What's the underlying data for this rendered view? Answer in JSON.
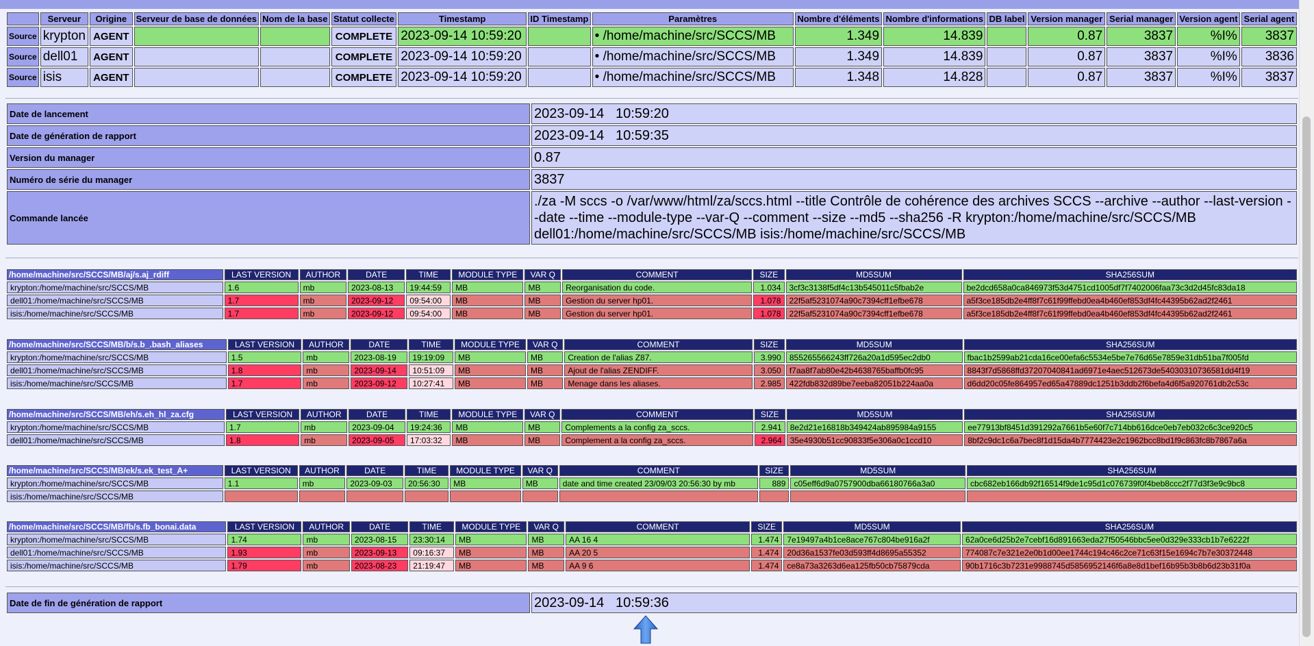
{
  "sources": {
    "headers": [
      "",
      "Serveur",
      "Origine",
      "Serveur de base de données",
      "Nom de la base",
      "Statut collecte",
      "Timestamp",
      "ID Timestamp",
      "Paramètres",
      "Nombre d'éléments",
      "Nombre d'informations",
      "DB label",
      "Version manager",
      "Serial manager",
      "Version agent",
      "Serial agent"
    ],
    "rows": [
      {
        "button": "Source",
        "server": "krypton",
        "origin": "AGENT",
        "db_server": "",
        "db_name": "",
        "status": "COMPLETE",
        "timestamp": "2023-09-14 10:59:20",
        "id_timestamp": "",
        "params": "• /home/machine/src/SCCS/MB",
        "elements": "1.349",
        "infos": "14.839",
        "db_label": "",
        "version_manager": "0.87",
        "serial_manager": "3837",
        "version_agent": "%I%",
        "serial_agent": "3837"
      },
      {
        "button": "Source",
        "server": "dell01",
        "origin": "AGENT",
        "db_server": "",
        "db_name": "",
        "status": "COMPLETE",
        "timestamp": "2023-09-14 10:59:20",
        "id_timestamp": "",
        "params": "• /home/machine/src/SCCS/MB",
        "elements": "1.349",
        "infos": "14.839",
        "db_label": "",
        "version_manager": "0.87",
        "serial_manager": "3837",
        "version_agent": "%I%",
        "serial_agent": "3836"
      },
      {
        "button": "Source",
        "server": "isis",
        "origin": "AGENT",
        "db_server": "",
        "db_name": "",
        "status": "COMPLETE",
        "timestamp": "2023-09-14 10:59:20",
        "id_timestamp": "",
        "params": "• /home/machine/src/SCCS/MB",
        "elements": "1.348",
        "infos": "14.828",
        "db_label": "",
        "version_manager": "0.87",
        "serial_manager": "3837",
        "version_agent": "%I%",
        "serial_agent": "3837"
      }
    ]
  },
  "info": {
    "launch_label": "Date de lancement",
    "launch_value": "2023-09-14   10:59:20",
    "report_label": "Date de génération de rapport",
    "report_value": "2023-09-14   10:59:35",
    "manager_version_label": "Version du manager",
    "manager_version_value": "0.87",
    "serial_label": "Numéro de série du manager",
    "serial_value": "3837",
    "command_label": "Commande lancée",
    "command_value": "./za -M sccs -o /var/www/html/za/sccs.html --title Contrôle de cohérence des archives SCCS --archive --author --last-version --date --time --module-type --var-Q --comment --size --md5 --sha256 -R krypton:/home/machine/src/SCCS/MB dell01:/home/machine/src/SCCS/MB isis:/home/machine/src/SCCS/MB"
  },
  "module_headers": [
    "LAST VERSION",
    "AUTHOR",
    "DATE",
    "TIME",
    "MODULE TYPE",
    "VAR Q",
    "COMMENT",
    "SIZE",
    "MD5SUM",
    "SHA256SUM"
  ],
  "modules": [
    {
      "name": "/home/machine/src/SCCS/MB/aj/s.aj_rdiff",
      "rows": [
        {
          "source": "krypton:/home/machine/src/SCCS/MB",
          "version": "1.6",
          "author": "mb",
          "date": "2023-08-13",
          "time": "19:44:59",
          "type": "MB",
          "varq": "MB",
          "comment": "Reorganisation du code.",
          "size": "1.034",
          "md5": "3cf3c3138f5df4c13b545011c5fbab2e",
          "sha": "be2dcd658a0ca846973f53d4751cd1005df7f7402006faa73c3d2d45fc83da18",
          "state": "ok"
        },
        {
          "source": "dell01:/home/machine/src/SCCS/MB",
          "version": "1.7",
          "author": "mb",
          "date": "2023-09-12",
          "time": "09:54:00",
          "type": "MB",
          "varq": "MB",
          "comment": "Gestion du server hp01.",
          "size": "1.078",
          "md5": "22f5af5231074a90c7394cff1efbe678",
          "sha": "a5f3ce185db2e4ff8f7c61f99ffebd0ea4b460ef853df4fc44395b62ad2f2461",
          "state": "diff"
        },
        {
          "source": "isis:/home/machine/src/SCCS/MB",
          "version": "1.7",
          "author": "mb",
          "date": "2023-09-12",
          "time": "09:54:00",
          "type": "MB",
          "varq": "MB",
          "comment": "Gestion du server hp01.",
          "size": "1.078",
          "md5": "22f5af5231074a90c7394cff1efbe678",
          "sha": "a5f3ce185db2e4ff8f7c61f99ffebd0ea4b460ef853df4fc44395b62ad2f2461",
          "state": "diff"
        }
      ]
    },
    {
      "name": "/home/machine/src/SCCS/MB/b/s.b_.bash_aliases",
      "rows": [
        {
          "source": "krypton:/home/machine/src/SCCS/MB",
          "version": "1.5",
          "author": "mb",
          "date": "2023-08-19",
          "time": "19:19:09",
          "type": "MB",
          "varq": "MB",
          "comment": "Creation de l'alias Z87.",
          "size": "3.990",
          "md5": "855265566243ff726a20a1d595ec2db0",
          "sha": "fbac1b2599ab21cda16ce00efa6c5534e5be7e76d65e7859e31db51ba7f005fd",
          "state": "ok"
        },
        {
          "source": "dell01:/home/machine/src/SCCS/MB",
          "version": "1.8",
          "author": "mb",
          "date": "2023-09-14",
          "time": "10:51:09",
          "type": "MB",
          "varq": "MB",
          "comment": "Ajout de l'alias ZENDIFF.",
          "size": "3.050",
          "md5": "f7aa8f7ab80e42b4638765baffb0fc95",
          "sha": "8843f7d5868ffd37207040841ad6971e4aec512673de54030310736581dd4f19",
          "state": "diff2"
        },
        {
          "source": "isis:/home/machine/src/SCCS/MB",
          "version": "1.7",
          "author": "mb",
          "date": "2023-09-12",
          "time": "10:27:41",
          "type": "MB",
          "varq": "MB",
          "comment": "Menage dans les aliases.",
          "size": "2.985",
          "md5": "422fdb832d89be7eeba82051b224aa0a",
          "sha": "d6dd20c05fe864957ed65a47889dc1251b3ddb2f6befa4d6f5a920761db2c53c",
          "state": "diff2"
        }
      ]
    },
    {
      "name": "/home/machine/src/SCCS/MB/eh/s.eh_hl_za.cfg",
      "rows": [
        {
          "source": "krypton:/home/machine/src/SCCS/MB",
          "version": "1.7",
          "author": "mb",
          "date": "2023-09-04",
          "time": "19:24:36",
          "type": "MB",
          "varq": "MB",
          "comment": "Complements a la config za_sccs.",
          "size": "2.941",
          "md5": "8e2d21e16818b349424ab895984a9155",
          "sha": "ee77913bf8451d391292a7661b5e60f7c714bb616dce0eb7eb032c6c3ce920c5",
          "state": "ok"
        },
        {
          "source": "dell01:/home/machine/src/SCCS/MB",
          "version": "1.8",
          "author": "mb",
          "date": "2023-09-05",
          "time": "17:03:32",
          "type": "MB",
          "varq": "MB",
          "comment": "Complement a la config za_sccs.",
          "size": "2.964",
          "md5": "35e4930b51cc90833f5e306a0c1ccd10",
          "sha": "8bf2c9dc1c6a7bec8f1d15da4b7774423e2c1962bcc8bd1f9c863fc8b7867a6a",
          "state": "diff"
        }
      ]
    },
    {
      "name": "/home/machine/src/SCCS/MB/ek/s.ek_test_A+",
      "rows": [
        {
          "source": "krypton:/home/machine/src/SCCS/MB",
          "version": "1.1",
          "author": "mb",
          "date": "2023-09-03",
          "time": "20:56:30",
          "type": "MB",
          "varq": "MB",
          "comment": "date and time created 23/09/03 20:56:30 by mb",
          "size": "889",
          "md5": "c05eff6d9a0757900dba66180766a3a0",
          "sha": "cbc682eb166db92f16514f9de1c95d1c076739f0f4beb8ccc2f77d3f3e9c9bc8",
          "state": "ok"
        },
        {
          "source": "isis:/home/machine/src/SCCS/MB",
          "version": "",
          "author": "",
          "date": "",
          "time": "",
          "type": "",
          "varq": "",
          "comment": "",
          "size": "",
          "md5": "",
          "sha": "",
          "state": "missing"
        }
      ]
    },
    {
      "name": "/home/machine/src/SCCS/MB/fb/s.fb_bonai.data",
      "rows": [
        {
          "source": "krypton:/home/machine/src/SCCS/MB",
          "version": "1.74",
          "author": "mb",
          "date": "2023-08-15",
          "time": "23:30:14",
          "type": "MB",
          "varq": "MB",
          "comment": "AA 16 4",
          "size": "1.474",
          "md5": "7e19497a4b1ce8ace767c804be916a2f",
          "sha": "62a0ce6d25b2e7cebf16d891663eda27f50546bbc5ee0d329e333cb1b7e6222f",
          "state": "ok"
        },
        {
          "source": "dell01:/home/machine/src/SCCS/MB",
          "version": "1.93",
          "author": "mb",
          "date": "2023-09-13",
          "time": "09:16:37",
          "type": "MB",
          "varq": "MB",
          "comment": "AA 20 5",
          "size": "1.474",
          "md5": "20d36a1537fe03d593ff4d8695a55352",
          "sha": "774087c7e321e2e0b1d00ee1744c194c46c2ce71c63f15e1694c7b7e30372448",
          "state": "diffsize"
        },
        {
          "source": "isis:/home/machine/src/SCCS/MB",
          "version": "1.79",
          "author": "mb",
          "date": "2023-08-23",
          "time": "21:19:47",
          "type": "MB",
          "varq": "MB",
          "comment": "AA 9 6",
          "size": "1.474",
          "md5": "ce8a73a3263d6ea125fb50cb75879cda",
          "sha": "90b1716c3b7231e9988745d5856952146f6a8e8d1bef16b95b3b8b6d23b31f0a",
          "state": "diffsize"
        }
      ]
    }
  ],
  "footer": {
    "end_label": "Date de fin de génération de rapport",
    "end_value": "2023-09-14   10:59:36"
  },
  "icons": {
    "up": "up-arrow-icon"
  },
  "colors": {
    "ok": "#8ee07c",
    "diff": "#e07a7a",
    "hot": "#ff3d63",
    "header": "#1e2470"
  }
}
